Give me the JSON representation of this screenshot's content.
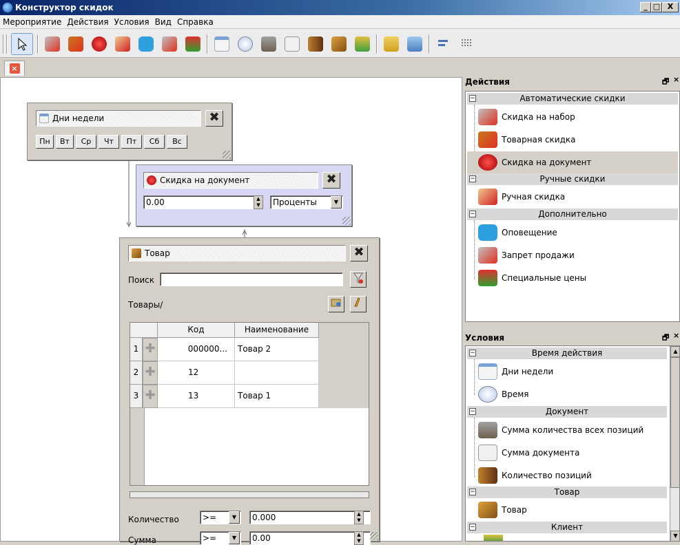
{
  "window": {
    "title": "Конструктор скидок",
    "minimize": "_",
    "maximize": "□",
    "close": "X"
  },
  "menu": [
    "Мероприятие",
    "Действия",
    "Условия",
    "Вид",
    "Справка"
  ],
  "toolbar": {
    "icons": [
      "pointer-icon",
      "set-discount-icon",
      "goods-discount-icon",
      "document-discount-icon",
      "manual-discount-icon",
      "notification-icon",
      "sale-ban-icon",
      "special-prices-icon",
      "weekdays-icon",
      "time-icon",
      "scales-icon",
      "sum-icon",
      "positions-icon",
      "product-icon",
      "client-icon",
      "open-folder-icon",
      "save-icon",
      "align-icon",
      "grid-icon"
    ]
  },
  "weekdays_node": {
    "title": "Дни недели",
    "days": [
      "Пн",
      "Вт",
      "Ср",
      "Чт",
      "Пт",
      "Сб",
      "Вс"
    ]
  },
  "discount_node": {
    "title": "Скидка на документ",
    "value": "0.00",
    "unit": "Проценты"
  },
  "product_node": {
    "title": "Товар",
    "search_label": "Поиск",
    "search_value": "",
    "breadcrumb": "Товары/",
    "columns": [
      "Код",
      "Наименование"
    ],
    "rows": [
      {
        "num": "1",
        "code": "000000...",
        "name": "Товар 2"
      },
      {
        "num": "2",
        "code": "12",
        "name": ""
      },
      {
        "num": "3",
        "code": "13",
        "name": "Товар 1"
      }
    ],
    "qty_label": "Количество",
    "qty_op": ">=",
    "qty_value": "0.000",
    "sum_label": "Сумма",
    "sum_op": ">=",
    "sum_value": "0.00"
  },
  "actions_panel": {
    "title": "Действия",
    "groups": [
      {
        "label": "Автоматические скидки",
        "items": [
          "Скидка на набор",
          "Товарная скидка",
          "Скидка на документ"
        ]
      },
      {
        "label": "Ручные скидки",
        "items": [
          "Ручная скидка"
        ]
      },
      {
        "label": "Дополнительно",
        "items": [
          "Оповещение",
          "Запрет продажи",
          "Специальные цены"
        ]
      }
    ]
  },
  "conditions_panel": {
    "title": "Условия",
    "groups": [
      {
        "label": "Время действия",
        "items": [
          "Дни недели",
          "Время"
        ]
      },
      {
        "label": "Документ",
        "items": [
          "Сумма количества всех позиций",
          "Сумма документа",
          "Количество позиций"
        ]
      },
      {
        "label": "Товар",
        "items": [
          "Товар"
        ]
      },
      {
        "label": "Клиент",
        "items": []
      }
    ]
  },
  "panel_controls": {
    "float": "🗗",
    "close": "×"
  },
  "colors": {
    "title_bar": "#0a246a",
    "discount_node_bg": "#d8d8f4",
    "accent_red": "#e8563e"
  }
}
